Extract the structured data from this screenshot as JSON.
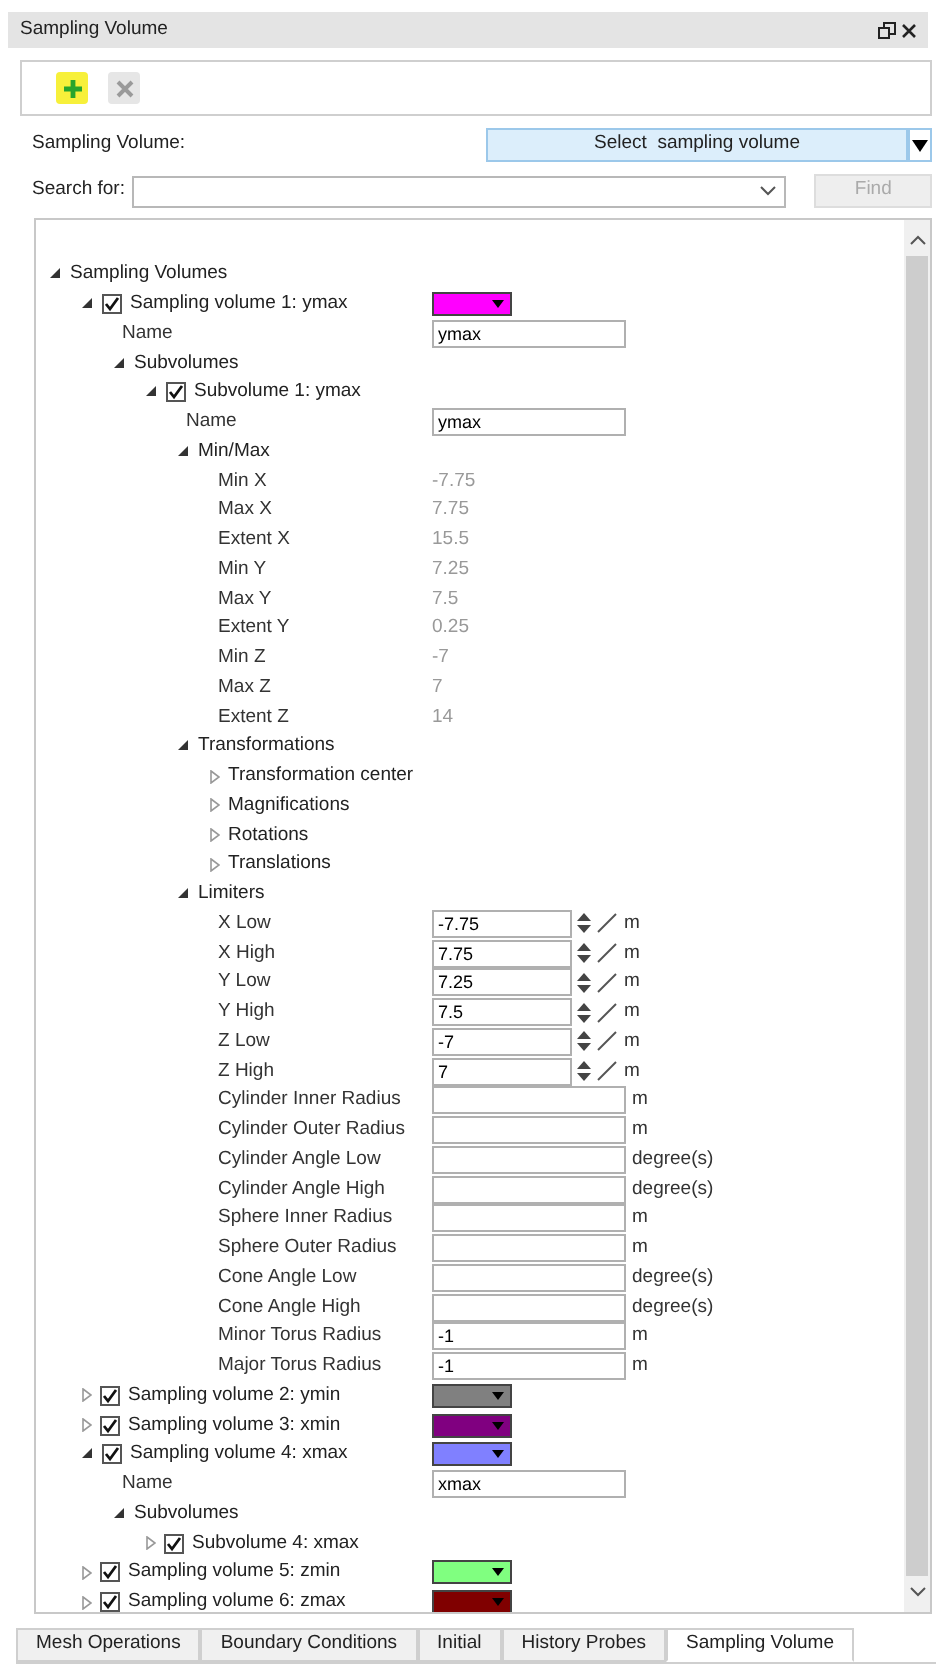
{
  "panel": {
    "title": "Sampling Volume"
  },
  "toolbar": {
    "add_disabled": false,
    "remove_disabled": true
  },
  "sampling_volume": {
    "label": "Sampling Volume:",
    "button": "Select  sampling volume"
  },
  "search": {
    "label": "Search for:",
    "find": {
      "label": "Find",
      "disabled": true
    }
  },
  "tree": {
    "kind": "group",
    "label": "Sampling Volumes",
    "expanded": true,
    "children": [
      {
        "kind": "volume",
        "label": "Sampling volume 1: ymax",
        "checked": true,
        "expanded": true,
        "color": "#ff00ff",
        "children": [
          {
            "kind": "field",
            "label": "Name",
            "value": "ymax"
          },
          {
            "kind": "group",
            "label": "Subvolumes",
            "expanded": true,
            "children": [
              {
                "kind": "volume",
                "label": "Subvolume 1: ymax",
                "checked": true,
                "expanded": true,
                "children": [
                  {
                    "kind": "field",
                    "label": "Name",
                    "value": "ymax"
                  },
                  {
                    "kind": "group",
                    "label": "Min/Max",
                    "expanded": true,
                    "children": [
                      {
                        "kind": "readonly",
                        "label": "Min X",
                        "value": "-7.75"
                      },
                      {
                        "kind": "readonly",
                        "label": "Max X",
                        "value": "7.75"
                      },
                      {
                        "kind": "readonly",
                        "label": "Extent X",
                        "value": "15.5"
                      },
                      {
                        "kind": "readonly",
                        "label": "Min Y",
                        "value": "7.25"
                      },
                      {
                        "kind": "readonly",
                        "label": "Max Y",
                        "value": "7.5"
                      },
                      {
                        "kind": "readonly",
                        "label": "Extent Y",
                        "value": "0.25"
                      },
                      {
                        "kind": "readonly",
                        "label": "Min Z",
                        "value": "-7"
                      },
                      {
                        "kind": "readonly",
                        "label": "Max Z",
                        "value": "7"
                      },
                      {
                        "kind": "readonly",
                        "label": "Extent Z",
                        "value": "14"
                      }
                    ]
                  },
                  {
                    "kind": "group",
                    "label": "Transformations",
                    "expanded": true,
                    "children": [
                      {
                        "kind": "group",
                        "label": "Transformation center",
                        "expanded": false
                      },
                      {
                        "kind": "group",
                        "label": "Magnifications",
                        "expanded": false
                      },
                      {
                        "kind": "group",
                        "label": "Rotations",
                        "expanded": false
                      },
                      {
                        "kind": "group",
                        "label": "Translations",
                        "expanded": false
                      }
                    ]
                  },
                  {
                    "kind": "group",
                    "label": "Limiters",
                    "expanded": true,
                    "children": [
                      {
                        "kind": "spin",
                        "label": "X Low",
                        "value": "-7.75",
                        "unit": "m"
                      },
                      {
                        "kind": "spin",
                        "label": "X High",
                        "value": "7.75",
                        "unit": "m"
                      },
                      {
                        "kind": "spin",
                        "label": "Y Low",
                        "value": "7.25",
                        "unit": "m"
                      },
                      {
                        "kind": "spin",
                        "label": "Y High",
                        "value": "7.5",
                        "unit": "m"
                      },
                      {
                        "kind": "spin",
                        "label": "Z Low",
                        "value": "-7",
                        "unit": "m"
                      },
                      {
                        "kind": "spin",
                        "label": "Z High",
                        "value": "7",
                        "unit": "m"
                      },
                      {
                        "kind": "input",
                        "label": "Cylinder Inner Radius",
                        "unit": "m"
                      },
                      {
                        "kind": "input",
                        "label": "Cylinder Outer Radius",
                        "unit": "m"
                      },
                      {
                        "kind": "input",
                        "label": "Cylinder Angle Low",
                        "unit": "degree(s)"
                      },
                      {
                        "kind": "input",
                        "label": "Cylinder Angle High",
                        "unit": "degree(s)"
                      },
                      {
                        "kind": "input",
                        "label": "Sphere Inner Radius",
                        "unit": "m"
                      },
                      {
                        "kind": "input",
                        "label": "Sphere Outer Radius",
                        "unit": "m"
                      },
                      {
                        "kind": "input",
                        "label": "Cone Angle Low",
                        "unit": "degree(s)"
                      },
                      {
                        "kind": "input",
                        "label": "Cone Angle High",
                        "unit": "degree(s)"
                      },
                      {
                        "kind": "input",
                        "label": "Minor Torus Radius",
                        "value": "-1",
                        "unit": "m"
                      },
                      {
                        "kind": "input",
                        "label": "Major Torus Radius",
                        "value": "-1",
                        "unit": "m"
                      }
                    ]
                  }
                ]
              }
            ]
          }
        ]
      },
      {
        "kind": "volume",
        "label": "Sampling volume 2: ymin",
        "checked": true,
        "expanded": false,
        "color": "#808080"
      },
      {
        "kind": "volume",
        "label": "Sampling volume 3: xmin",
        "checked": true,
        "expanded": false,
        "color": "#800080"
      },
      {
        "kind": "volume",
        "label": "Sampling volume 4: xmax",
        "checked": true,
        "expanded": true,
        "color": "#8080ff",
        "children": [
          {
            "kind": "field",
            "label": "Name",
            "value": "xmax"
          },
          {
            "kind": "group",
            "label": "Subvolumes",
            "expanded": true,
            "children": [
              {
                "kind": "volume",
                "label": "Subvolume 4: xmax",
                "checked": true,
                "expanded": false
              }
            ]
          }
        ]
      },
      {
        "kind": "volume",
        "label": "Sampling volume 5: zmin",
        "checked": true,
        "expanded": false,
        "color": "#80ff80"
      },
      {
        "kind": "volume",
        "label": "Sampling volume 6: zmax",
        "checked": true,
        "expanded": false,
        "color": "#800000"
      }
    ]
  },
  "tabs": [
    {
      "label": "Mesh Operations",
      "selected": false
    },
    {
      "label": "Boundary Conditions",
      "selected": false
    },
    {
      "label": "Initial",
      "selected": false
    },
    {
      "label": "History Probes",
      "selected": false
    },
    {
      "label": "Sampling Volume",
      "selected": true
    }
  ]
}
